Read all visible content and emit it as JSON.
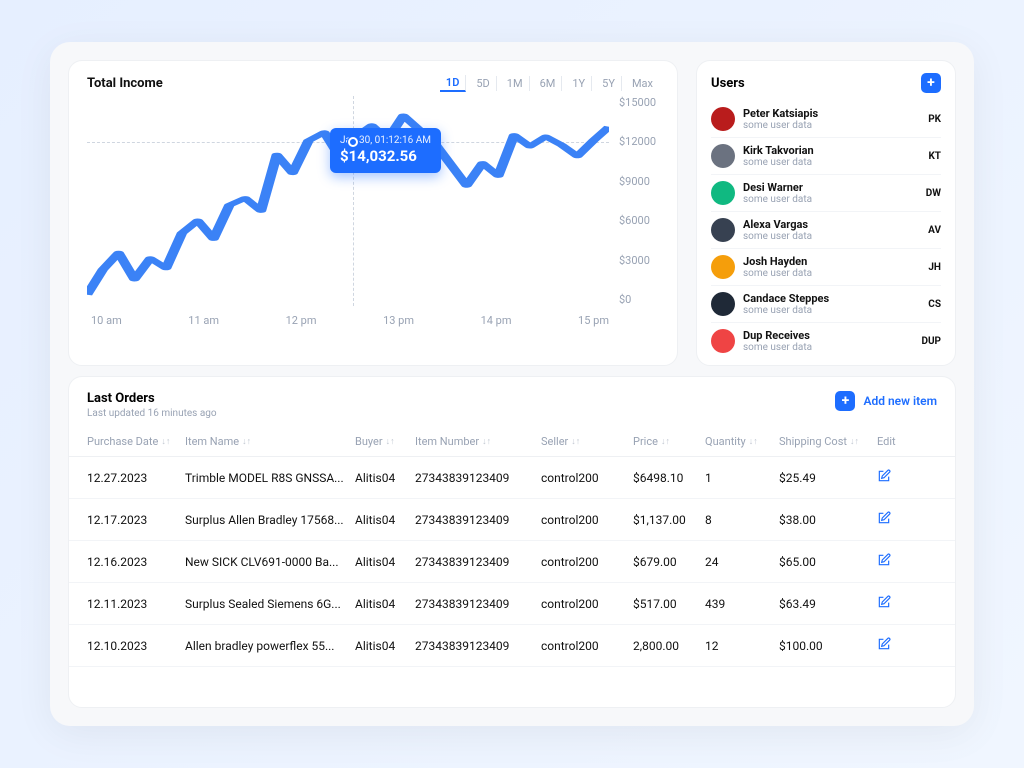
{
  "chart": {
    "title": "Total Income",
    "ranges": [
      "1D",
      "5D",
      "1M",
      "6M",
      "1Y",
      "5Y",
      "Max"
    ],
    "active_range": "1D",
    "tooltip_time": "Jan 30, 01:12:16 AM",
    "tooltip_value": "$14,032.56",
    "y_ticks": [
      "$15000",
      "$12000",
      "$9000",
      "$6000",
      "$3000",
      "$0"
    ],
    "x_ticks": [
      "10 am",
      "11 am",
      "12 pm",
      "13 pm",
      "14 pm",
      "15 pm"
    ]
  },
  "users": {
    "title": "Users",
    "add_icon": "+",
    "subtext": "some user data",
    "items": [
      {
        "name": "Peter Katsiapis",
        "initials": "PK",
        "avatar_color": "#b91c1c"
      },
      {
        "name": "Kirk Takvorian",
        "initials": "KT",
        "avatar_color": "#6b7280"
      },
      {
        "name": "Desi Warner",
        "initials": "DW",
        "avatar_color": "#10b981"
      },
      {
        "name": "Alexa Vargas",
        "initials": "AV",
        "avatar_color": "#374151"
      },
      {
        "name": "Josh Hayden",
        "initials": "JH",
        "avatar_color": "#f59e0b"
      },
      {
        "name": "Candace Steppes",
        "initials": "CS",
        "avatar_color": "#1f2937"
      },
      {
        "name": "Dup Receives",
        "initials": "DUP",
        "avatar_color": "#ef4444"
      }
    ]
  },
  "orders": {
    "title": "Last Orders",
    "subtitle": "Last updated 16 minutes ago",
    "add_label": "Add new item",
    "add_icon": "+",
    "columns": [
      "Purchase Date",
      "Item Name",
      "Buyer",
      "Item Number",
      "Seller",
      "Price",
      "Quantity",
      "Shipping Cost",
      "Edit"
    ],
    "rows": [
      {
        "date": "12.27.2023",
        "name": "Trimble MODEL R8S GNSSA...",
        "buyer": "Alitis04",
        "number": "27343839123409",
        "seller": "control200",
        "price": "$6498.10",
        "qty": "1",
        "ship": "$25.49"
      },
      {
        "date": "12.17.2023",
        "name": "Surplus Allen Bradley 17568...",
        "buyer": "Alitis04",
        "number": "27343839123409",
        "seller": "control200",
        "price": "$1,137.00",
        "qty": "8",
        "ship": "$38.00"
      },
      {
        "date": "12.16.2023",
        "name": "New SICK CLV691-0000 Ba...",
        "buyer": "Alitis04",
        "number": "27343839123409",
        "seller": "control200",
        "price": "$679.00",
        "qty": "24",
        "ship": "$65.00"
      },
      {
        "date": "12.11.2023",
        "name": "Surplus Sealed Siemens 6G...",
        "buyer": "Alitis04",
        "number": "27343839123409",
        "seller": "control200",
        "price": "$517.00",
        "qty": "439",
        "ship": "$63.49"
      },
      {
        "date": "12.10.2023",
        "name": "Allen bradley powerflex 55...",
        "buyer": "Alitis04",
        "number": "27343839123409",
        "seller": "control200",
        "price": "2,800.00",
        "qty": "12",
        "ship": "$100.00"
      }
    ]
  },
  "chart_data": {
    "type": "line",
    "title": "Total Income",
    "xlabel": "",
    "ylabel": "",
    "ylim": [
      0,
      15000
    ],
    "x": [
      "10 am",
      "11 am",
      "12 pm",
      "13 pm",
      "14 pm",
      "15 pm"
    ],
    "values_sampled": [
      800,
      2600,
      3800,
      1900,
      3400,
      2700,
      5200,
      6100,
      4800,
      7200,
      7700,
      6800,
      10800,
      9500,
      11800,
      12400,
      10600,
      12100,
      12900,
      11900,
      13600,
      12600,
      11600,
      10100,
      8600,
      10200,
      9300,
      12200,
      11400,
      12100,
      11500,
      10700,
      11800,
      12800
    ],
    "tooltip_point": {
      "time": "Jan 30, 01:12:16 AM",
      "value": 14032.56
    }
  }
}
